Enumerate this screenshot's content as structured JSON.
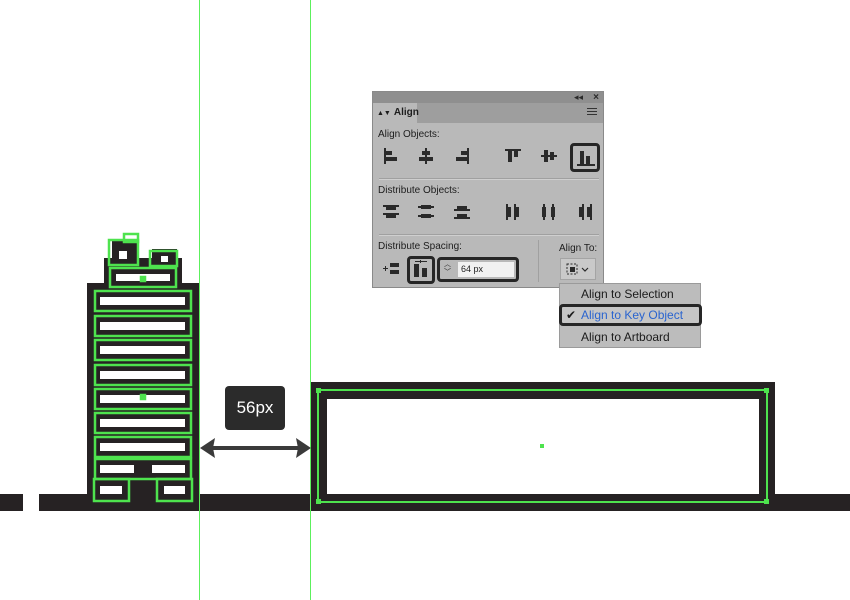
{
  "canvas": {
    "measure_label": "56px",
    "colors": {
      "stroke": "#262223",
      "guide": "#5cf05c",
      "selection": "#4ee34e",
      "background": "#ffffff"
    }
  },
  "align_panel": {
    "tab_label": "Align",
    "collapse_icon": "double-chevron-icon",
    "close_icon": "close-icon",
    "menu_icon": "hamburger-menu-icon",
    "sections": {
      "align_objects": "Align Objects:",
      "distribute_objects": "Distribute Objects:",
      "distribute_spacing": "Distribute Spacing:",
      "align_to": "Align To:"
    },
    "align_buttons": [
      "horizontal-align-left-icon",
      "horizontal-align-center-icon",
      "horizontal-align-right-icon",
      "vertical-align-top-icon",
      "vertical-align-center-icon",
      "vertical-align-bottom-icon"
    ],
    "distribute_buttons": [
      "vertical-distribute-top-icon",
      "vertical-distribute-center-icon",
      "vertical-distribute-bottom-icon",
      "horizontal-distribute-left-icon",
      "horizontal-distribute-center-icon",
      "horizontal-distribute-right-icon"
    ],
    "spacing_value": "64 px",
    "active_align_button": "vertical-align-bottom"
  },
  "align_to_menu": {
    "items": [
      "Align to Selection",
      "Align to Key Object",
      "Align to Artboard"
    ],
    "selected": "Align to Key Object",
    "selected_color": "#2a64cf"
  }
}
